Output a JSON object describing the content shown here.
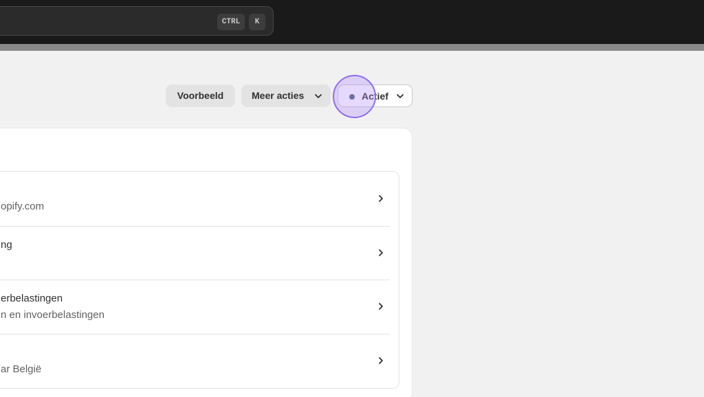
{
  "topbar": {
    "shortcut_ctrl": "CTRL",
    "shortcut_k": "K"
  },
  "header_actions": {
    "preview_label": "Voorbeeld",
    "more_actions_label": "Meer acties",
    "status_label": "Actief",
    "status_color": "#4a6177"
  },
  "settings_list": {
    "items": [
      {
        "line1": "",
        "line2": "opify.com"
      },
      {
        "line1": "ng",
        "line2": ""
      },
      {
        "line1": "erbelastingen",
        "line2": "n en invoerbelastingen"
      },
      {
        "line1": "",
        "line2": "ar België"
      }
    ]
  }
}
